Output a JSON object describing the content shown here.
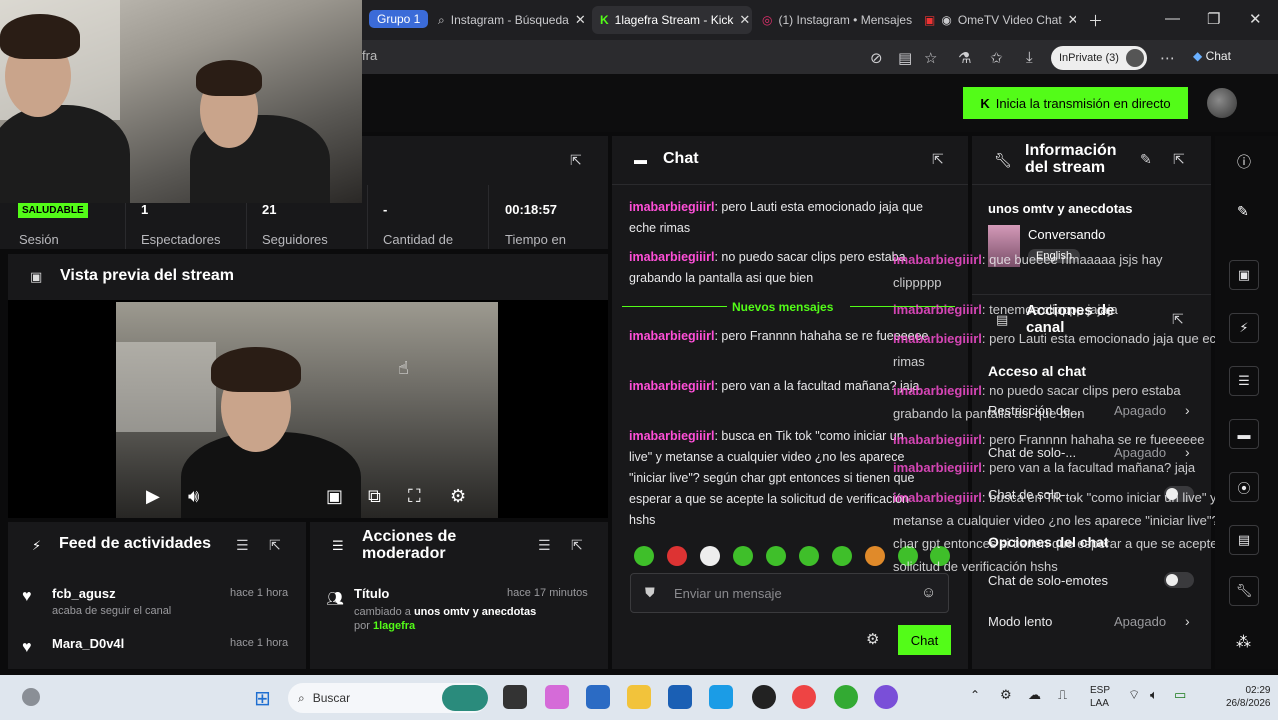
{
  "browser": {
    "group_label": "Grupo 1",
    "tabs": [
      {
        "label": "Instagram - Búsqueda",
        "active": false
      },
      {
        "label": "1lagefra Stream - Kick",
        "active": true
      },
      {
        "label": "(1) Instagram • Mensajes",
        "active": false
      },
      {
        "label": "OmeTV Video Chat",
        "active": false
      }
    ],
    "address": "fra",
    "inprivate_label": "InPrivate (3)",
    "copilot_label": "Chat"
  },
  "header": {
    "go_live_label": "Inicia la transmisión en directo"
  },
  "stats": {
    "health_badge": "SALUDABLE",
    "items": [
      {
        "value": "",
        "label": "Sesión"
      },
      {
        "value": "1",
        "label": "Espectadores"
      },
      {
        "value": "21",
        "label": "Seguidores"
      },
      {
        "value": "-",
        "label": "Cantidad de"
      },
      {
        "value": "00:18:57",
        "label": "Tiempo en"
      }
    ]
  },
  "preview": {
    "title": "Vista previa del stream"
  },
  "feed": {
    "title": "Feed de actividades",
    "items": [
      {
        "user": "fcb_agusz",
        "action": "acaba de seguir el canal",
        "time": "hace 1 hora"
      },
      {
        "user": "Mara_D0v4l",
        "action": "",
        "time": "hace 1 hora"
      }
    ]
  },
  "mod": {
    "title": "Acciones de moderador",
    "items": [
      {
        "label": "Título",
        "time": "hace 17 minutos",
        "detail_prefix": "cambiado a ",
        "detail_value": "unos omtv y anecdotas",
        "detail_by": " por ",
        "by_user": "1lagefra"
      }
    ]
  },
  "chat": {
    "title": "Chat",
    "new_messages_label": "Nuevos mensajes",
    "messages": [
      {
        "user": "imabarbiegiiirl",
        "text": "pero Lauti esta emocionado jaja que eche rimas"
      },
      {
        "user": "imabarbiegiiirl",
        "text": "no puedo sacar clips pero estaba grabando la pantalla asi que bien"
      },
      {
        "user": "imabarbiegiiirl",
        "text": "pero Frannnn hahaha se re fueeeeee"
      },
      {
        "user": "imabarbiegiiirl",
        "text": "pero van a la facultad mañana? jaja"
      },
      {
        "user": "imabarbiegiiirl",
        "text": "busca en Tik tok \"como iniciar un live\" y metanse a cualquier video ¿no les aparece \"iniciar live\"? según char gpt entonces si tienen que esperar a que se acepte la solicitud de verificación hshs"
      }
    ],
    "input_placeholder": "Enviar un mensaje",
    "send_label": "Chat"
  },
  "overlay_chat": [
    {
      "user": "imabarbiegiiirl",
      "text": "que bueeee rimaaaaa jsjs hay clippppp"
    },
    {
      "user": "imabarbiegiiirl",
      "text": "tenemos clipppp jajaja"
    },
    {
      "user": "imabarbiegiiirl",
      "text": "pero Lauti esta emocionado jaja que eche rimas"
    },
    {
      "user": "imabarbiegiiirl",
      "text": "no puedo sacar clips pero estaba grabando la pantalla asi que bien"
    },
    {
      "user": "imabarbiegiiirl",
      "text": "pero Frannnn hahaha se re fueeeeee"
    },
    {
      "user": "imabarbiegiiirl",
      "text": "pero van a la facultad mañana? jaja"
    },
    {
      "user": "imabarbiegiiirl",
      "text": "busca en Tik tok \"como iniciar un live\" y metanse a cualquier video ¿no les aparece \"iniciar live\"? según char gpt entonces si tienen que esperar a que se acepte la solicitud de verificación hshs"
    }
  ],
  "info": {
    "title": "Información del stream",
    "stream_title": "unos omtv y anecdotas",
    "category": "Conversando",
    "tag": "English",
    "channel_actions": "Acciones de canal",
    "chat_access": "Acceso al chat",
    "rows": [
      {
        "label": "Restricción de...",
        "value": "Apagado"
      },
      {
        "label": "Chat de solo-...",
        "value": "Apagado"
      },
      {
        "label": "Chat de solo-...",
        "value": ""
      }
    ],
    "chat_options": "Opciones del chat",
    "emotes_only": "Chat de solo-emotes",
    "slow_mode": "Modo lento",
    "slow_value": "Apagado"
  },
  "taskbar": {
    "search_placeholder": "Buscar",
    "lang_top": "ESP",
    "lang_bottom": "LAA",
    "time": "02:29",
    "date": "26/8/2026"
  }
}
